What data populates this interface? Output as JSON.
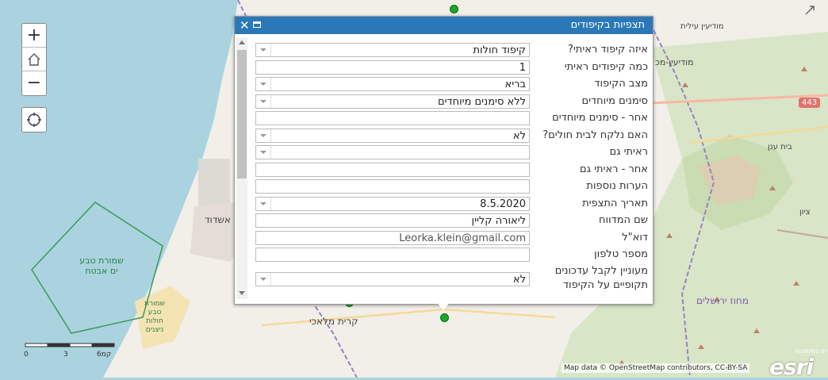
{
  "map": {
    "labels": {
      "ashdod": "אשדוד",
      "kiryat_malachi": "קרית מלאכי",
      "modiin_illit": "מודיעין עילית",
      "modiin": "מודיעין-מכ",
      "beit_anan": "בית ענן",
      "road_443": "443",
      "jerusalem_district": "מחוז ירושלים",
      "reserve_sea": "שמורת טבע ים אבטח",
      "reserve_dunes": "שמורת טבע חולות ניצנים",
      "tzion": "ציון"
    },
    "scale": {
      "zero": "0",
      "three": "3",
      "six": "6קמ"
    },
    "attribution": "Map data © OpenStreetMap contributors, CC-BY-SA",
    "esri_powered": "POWERED BY",
    "esri_logo": "esri"
  },
  "controls": {
    "zoom_in": "+",
    "zoom_out": "−"
  },
  "popup": {
    "title": "תצפיות בקיפודים",
    "close": "✕",
    "fields": [
      {
        "label": "איזה קיפוד ראיתי?",
        "value": "קיפוד חולות",
        "dropdown": true
      },
      {
        "label": "כמה קיפודים ראיתי",
        "value": "1",
        "dropdown": false
      },
      {
        "label": "מצב הקיפוד",
        "value": "בריא",
        "dropdown": true
      },
      {
        "label": "סימנים מיוחדים",
        "value": "ללא סימנים מיוחדים",
        "dropdown": true
      },
      {
        "label": "אחר - סימנים מיוחדים",
        "value": "",
        "dropdown": false
      },
      {
        "label": "האם נלקח לבית חולים?",
        "value": "לא",
        "dropdown": true
      },
      {
        "label": "ראיתי גם",
        "value": "",
        "dropdown": true
      },
      {
        "label": "אחר - ראיתי גם",
        "value": "",
        "dropdown": false
      },
      {
        "label": "הערות נוספות",
        "value": "",
        "dropdown": false
      },
      {
        "label": "תאריך התצפית",
        "value": "8.5.2020",
        "dropdown": true
      },
      {
        "label": "שם המדווח",
        "value": "ליאורה קליין",
        "dropdown": false
      },
      {
        "label": "דוא\"ל",
        "value": "Leorka.klein@gmail.com",
        "dropdown": false
      },
      {
        "label": "מספר טלפון",
        "value": "",
        "dropdown": false
      },
      {
        "label": "מעוניין לקבל עדכונים תקופיים על הקיפוד",
        "value": "לא",
        "dropdown": true
      }
    ]
  },
  "colors": {
    "sea": "#aad3df",
    "land": "#f2efe9",
    "header": "#2b78b8",
    "dot": "#1aa829"
  }
}
